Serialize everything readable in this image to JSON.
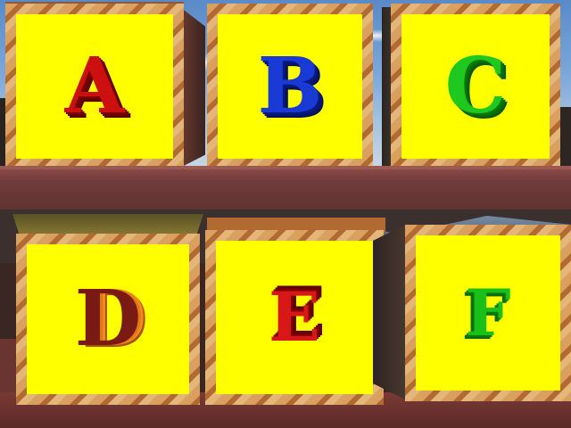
{
  "blocks": [
    {
      "id": "a",
      "letter": "A",
      "color": "#cc1010"
    },
    {
      "id": "b",
      "letter": "B",
      "color": "#1a3ad6"
    },
    {
      "id": "c",
      "letter": "C",
      "color": "#1ec81e"
    },
    {
      "id": "d",
      "letter": "D",
      "color": "#7a1a14"
    },
    {
      "id": "e",
      "letter": "E",
      "color": "#d81818"
    },
    {
      "id": "f",
      "letter": "F",
      "color": "#18c018"
    }
  ],
  "colors": {
    "block_face": "#ffff00",
    "block_edge": "#c98a4a",
    "shelf": "#6f3a3a",
    "sky": "#7aa6d8"
  }
}
